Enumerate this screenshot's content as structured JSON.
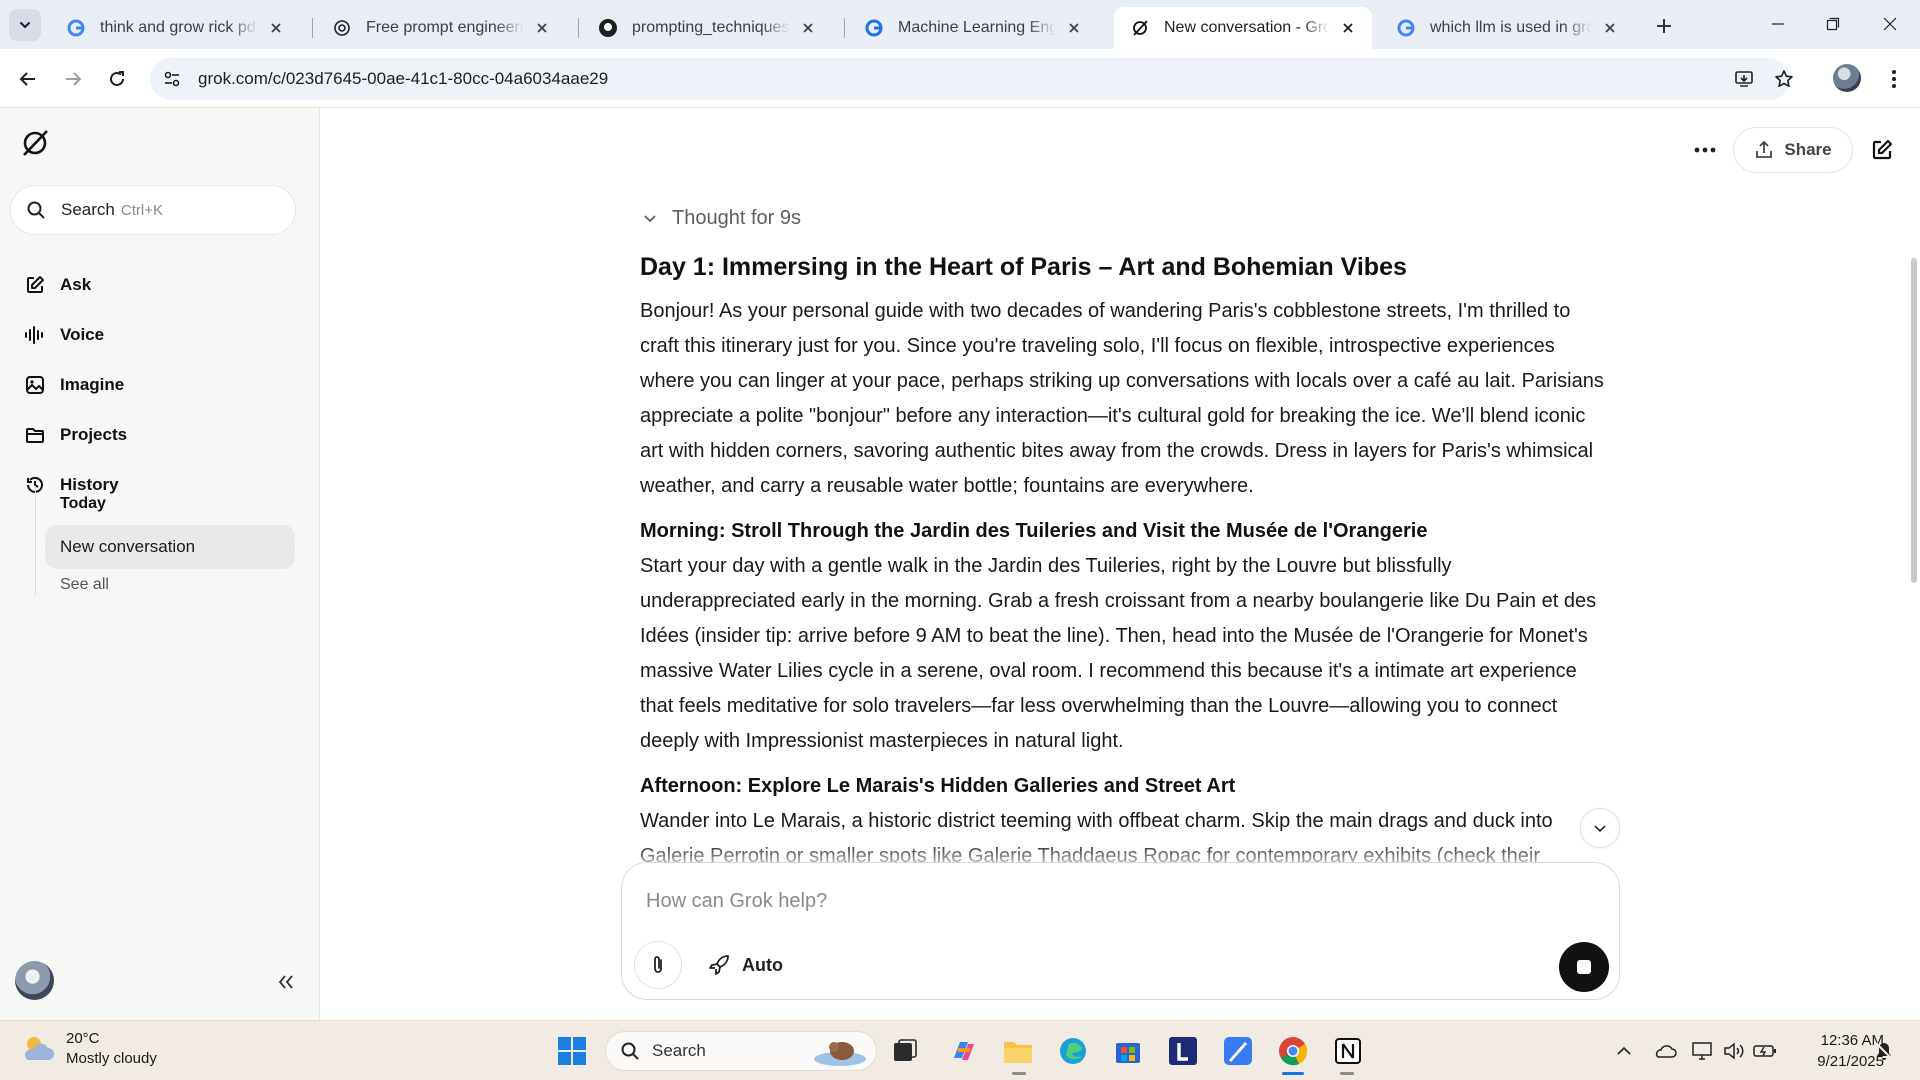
{
  "browser": {
    "tabs": [
      {
        "title": "think and grow rick pdf - Google Search",
        "favicon": "google-icon",
        "active": false
      },
      {
        "title": "Free prompt engineering course",
        "favicon": "openai-icon",
        "active": false
      },
      {
        "title": "prompting_techniques_on_github",
        "favicon": "github-icon",
        "active": false
      },
      {
        "title": "Machine Learning Engineer",
        "favicon": "google-icon",
        "active": false
      },
      {
        "title": "New conversation - Grok",
        "favicon": "grok-icon",
        "active": true
      },
      {
        "title": "which llm is used in grok - Google Search",
        "favicon": "google-icon",
        "active": false
      }
    ],
    "url": "grok.com/c/023d7645-00ae-41c1-80cc-04a6034aae29"
  },
  "sidebar": {
    "search_label": "Search",
    "search_shortcut": "Ctrl+K",
    "nav": [
      {
        "label": "Ask",
        "icon": "pencil-square-icon"
      },
      {
        "label": "Voice",
        "icon": "waveform-icon"
      },
      {
        "label": "Imagine",
        "icon": "image-icon"
      },
      {
        "label": "Projects",
        "icon": "folder-icon"
      },
      {
        "label": "History",
        "icon": "history-icon"
      }
    ],
    "history": {
      "group_label": "Today",
      "items": [
        "New conversation"
      ],
      "see_all": "See all"
    }
  },
  "header": {
    "share_label": "Share"
  },
  "message": {
    "thought_label": "Thought for 9s",
    "title": "Day 1: Immersing in the Heart of Paris – Art and Bohemian Vibes",
    "intro": "Bonjour! As your personal guide with two decades of wandering Paris's cobblestone streets, I'm thrilled to craft this itinerary just for you. Since you're traveling solo, I'll focus on flexible, introspective experiences where you can linger at your pace, perhaps striking up conversations with locals over a café au lait. Parisians appreciate a polite \"bonjour\" before any interaction—it's cultural gold for breaking the ice. We'll blend iconic art with hidden corners, savoring authentic bites away from the crowds. Dress in layers for Paris's whimsical weather, and carry a reusable water bottle; fountains are everywhere.",
    "sections": [
      {
        "heading": "Morning: Stroll Through the Jardin des Tuileries and Visit the Musée de l'Orangerie",
        "body": "Start your day with a gentle walk in the Jardin des Tuileries, right by the Louvre but blissfully underappreciated early in the morning. Grab a fresh croissant from a nearby boulangerie like Du Pain et des Idées (insider tip: arrive before 9 AM to beat the line). Then, head into the Musée de l'Orangerie for Monet's massive Water Lilies cycle in a serene, oval room. I recommend this because it's a intimate art experience that feels meditative for solo travelers—far less overwhelming than the Louvre—allowing you to connect deeply with Impressionist masterpieces in natural light."
      },
      {
        "heading": "Afternoon: Explore Le Marais's Hidden Galleries and Street Art",
        "body": "Wander into Le Marais, a historic district teeming with offbeat charm. Skip the main drags and duck into Galerie Perrotin or smaller spots like Galerie Thaddaeus Ropac for contemporary exhibits (check their"
      }
    ]
  },
  "composer": {
    "placeholder": "How can Grok help?",
    "mode_label": "Auto"
  },
  "taskbar": {
    "temperature": "20°C",
    "condition": "Mostly cloudy",
    "search_label": "Search",
    "time": "12:36 AM",
    "date": "9/21/2025"
  },
  "colors": {
    "tabstrip_bg": "#e8edf6",
    "sidebar_bg": "#f7f7f6",
    "taskbar_bg": "#f2ebe4",
    "stop_button": "#111111"
  }
}
